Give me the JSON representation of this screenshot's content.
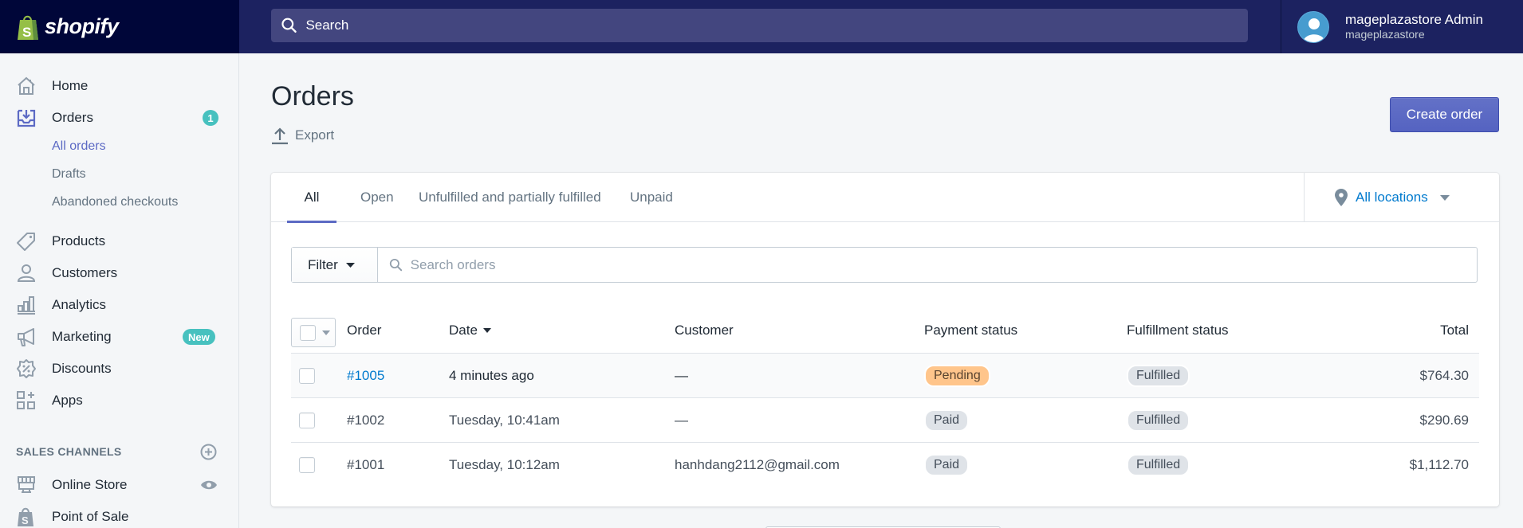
{
  "topbar": {
    "brand": "shopify",
    "search_placeholder": "Search",
    "user_name": "mageplazastore Admin",
    "store_name": "mageplazastore"
  },
  "sidebar": {
    "items": [
      {
        "label": "Home",
        "icon": "home-icon"
      },
      {
        "label": "Orders",
        "icon": "orders-icon",
        "badge": "1"
      },
      {
        "label": "Products",
        "icon": "tag-icon"
      },
      {
        "label": "Customers",
        "icon": "person-icon"
      },
      {
        "label": "Analytics",
        "icon": "bar-chart-icon"
      },
      {
        "label": "Marketing",
        "icon": "megaphone-icon",
        "badge": "New"
      },
      {
        "label": "Discounts",
        "icon": "discount-icon"
      },
      {
        "label": "Apps",
        "icon": "apps-icon"
      }
    ],
    "orders_sub": [
      {
        "label": "All orders",
        "active": true
      },
      {
        "label": "Drafts"
      },
      {
        "label": "Abandoned checkouts"
      }
    ],
    "sales_channels_title": "SALES CHANNELS",
    "channels": [
      {
        "label": "Online Store",
        "icon": "store-icon"
      },
      {
        "label": "Point of Sale",
        "icon": "shopify-bag-icon"
      }
    ]
  },
  "main": {
    "title": "Orders",
    "export_label": "Export",
    "create_label": "Create order",
    "tabs": [
      {
        "label": "All",
        "active": true
      },
      {
        "label": "Open"
      },
      {
        "label": "Unfulfilled and partially fulfilled"
      },
      {
        "label": "Unpaid"
      }
    ],
    "location_filter": "All locations",
    "filter_label": "Filter",
    "search_placeholder": "Search orders",
    "columns": [
      "Order",
      "Date",
      "Customer",
      "Payment status",
      "Fulfillment status",
      "Total"
    ],
    "rows": [
      {
        "order": "#1005",
        "date": "4 minutes ago",
        "customer": "—",
        "payment": "Pending",
        "fulfillment": "Fulfilled",
        "total": "$764.30"
      },
      {
        "order": "#1002",
        "date": "Tuesday, 10:41am",
        "customer": "—",
        "payment": "Paid",
        "fulfillment": "Fulfilled",
        "total": "$290.69"
      },
      {
        "order": "#1001",
        "date": "Tuesday, 10:12am",
        "customer": "hanhdang2112@gmail.com",
        "payment": "Paid",
        "fulfillment": "Fulfilled",
        "total": "$1,112.70"
      }
    ]
  },
  "colors": {
    "topbar": "#1c2260",
    "logo_bg": "#000639",
    "accent": "#5c6ac4",
    "link": "#007ace",
    "badge_teal": "#47c1bf",
    "pending": "#ffc58b"
  }
}
